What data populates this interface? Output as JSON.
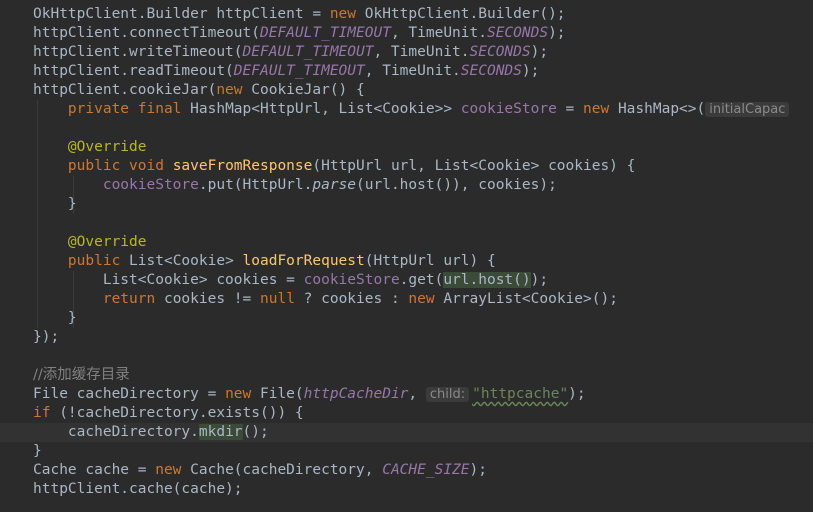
{
  "colors": {
    "background": "#2b2b2b",
    "caret_line": "#323232",
    "keyword": "#cc7832",
    "field": "#9876aa",
    "method": "#ffc66d",
    "annotation": "#bbb529",
    "string": "#6a8759",
    "comment": "#808080",
    "default_text": "#a9b7c6"
  },
  "code": {
    "l1": {
      "a": "OkHttpClient.Builder httpClient = ",
      "kw_new": "new",
      "b": " OkHttpClient.Builder();"
    },
    "l2": {
      "a": "httpClient.connectTimeout(",
      "c1": "DEFAULT_TIMEOUT",
      "b": ", TimeUnit.",
      "c2": "SECONDS",
      "e": ");"
    },
    "l3": {
      "a": "httpClient.writeTimeout(",
      "c1": "DEFAULT_TIMEOUT",
      "b": ", TimeUnit.",
      "c2": "SECONDS",
      "e": ");"
    },
    "l4": {
      "a": "httpClient.readTimeout(",
      "c1": "DEFAULT_TIMEOUT",
      "b": ", TimeUnit.",
      "c2": "SECONDS",
      "e": ");"
    },
    "l5": {
      "a": "httpClient.cookieJar(",
      "kw_new": "new",
      "b": " CookieJar() {"
    },
    "l6": {
      "kw": "private final",
      "a": " HashMap<HttpUrl, List<Cookie>> ",
      "fld": "cookieStore",
      "b": " = ",
      "kw_new": "new",
      "c": " HashMap<>(",
      "hint": "initialCapac"
    },
    "l8": {
      "ann": "@Override"
    },
    "l9": {
      "kw": "public void",
      "sp": " ",
      "mth": "saveFromResponse",
      "a": "(HttpUrl url, List<Cookie> cookies) {"
    },
    "l10": {
      "fld": "cookieStore",
      "a": ".put(HttpUrl.",
      "it": "parse",
      "b": "(url.host()), cookies);"
    },
    "l11": {
      "a": "}"
    },
    "l13": {
      "ann": "@Override"
    },
    "l14": {
      "kw": "public",
      "a": " List<Cookie> ",
      "mth": "loadForRequest",
      "b": "(HttpUrl url) {"
    },
    "l15": {
      "a": "List<Cookie> cookies = ",
      "fld": "cookieStore",
      "b": ".get(",
      "hl": "url.host()",
      "c": ");"
    },
    "l16": {
      "kw": "return",
      "a": " cookies != ",
      "kw_null": "null",
      "b": " ? cookies : ",
      "kw_new": "new",
      "c": " ArrayList<Cookie>();"
    },
    "l17": {
      "a": "}"
    },
    "l18": {
      "a": "});"
    },
    "l20": {
      "cmt": "//添加缓存目录"
    },
    "l21": {
      "a": "File cacheDirectory = ",
      "kw_new": "new",
      "b": " File(",
      "it": "httpCacheDir",
      "c": ", ",
      "hint": "child:",
      "str": "\"httpcache\"",
      "e": ");"
    },
    "l22": {
      "kw": "if",
      "a": " (!cacheDirectory.exists()) {"
    },
    "l23": {
      "a": "cacheDirectory.",
      "mk": "mkdir",
      "b": "();"
    },
    "l24": {
      "a": "}"
    },
    "l25": {
      "a": "Cache cache = ",
      "kw_new": "new",
      "b": " Cache(cacheDirectory, ",
      "cst": "CACHE_SIZE",
      "e": ");"
    },
    "l26": {
      "a": "httpClient.cache(cache);"
    }
  }
}
